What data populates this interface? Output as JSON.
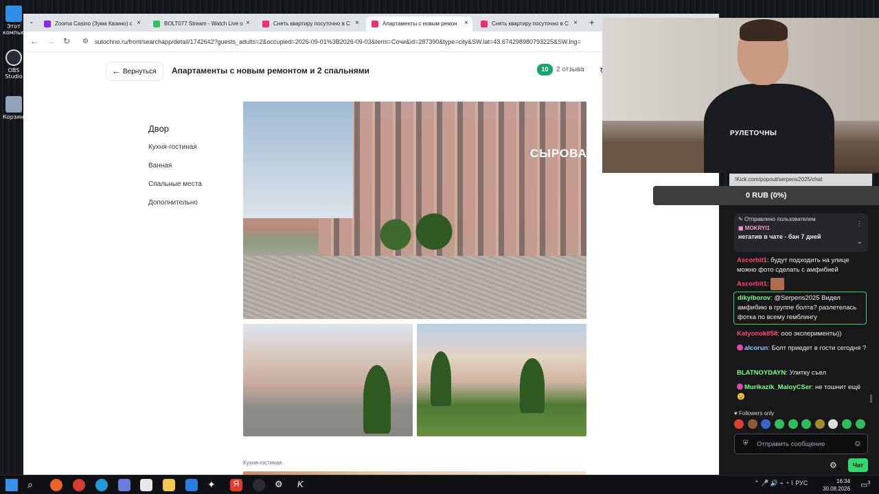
{
  "desktop": {
    "icons": [
      {
        "label": "Этот компьютер",
        "color": "#2f8fe8"
      },
      {
        "label": "OBS Studio",
        "color": "#2a2d33"
      },
      {
        "label": "Корзина",
        "color": "#8fa3b8"
      }
    ]
  },
  "browser": {
    "tabs": [
      {
        "title": "Zooma Casino (Зума Казино) с",
        "fav_color": "#8a2be2"
      },
      {
        "title": "BOLT077 Stream - Watch Live o",
        "fav_color": "#31c45a"
      },
      {
        "title": "Снять квартиру посуточно в С",
        "fav_color": "#e8336d"
      },
      {
        "title": "Апартаменты с новым ремон",
        "fav_color": "#e8336d"
      },
      {
        "title": "Снять квартиру посуточно в С",
        "fav_color": "#e8336d"
      }
    ],
    "new_tab": "+",
    "tab_list_icon": "chevron-down",
    "close_glyph": "×",
    "nav": {
      "back": "←",
      "forward": "→",
      "reload": "↻"
    },
    "url": "sutochno.ru/front/searchapp/detail/1742642?guests_adults=2&occupied=2026-09-01%3B2026-09-03&term=Сочи&id=287390&type=city&SW.lat=43.674298980793225&SW.lng="
  },
  "page": {
    "back_label": "Вернуться",
    "title": "Апартаменты с новым ремонтом и 2 спальнями",
    "rating": "10",
    "reviews": "2 отзыва",
    "active_section": "Двор",
    "sections": [
      "Кухня-гостиная",
      "Ванная",
      "Спальные места",
      "Дополнительно"
    ],
    "photo_sign": "СЫРОВА",
    "kitchen_caption": "Кухня-гостиная"
  },
  "webcam": {
    "shirt_text": "РУЛЕТОЧНЫ"
  },
  "overlay": {
    "chat_url": "!Kick.com/popout/serpens2025/chat",
    "donation": "0 RUB (0%)"
  },
  "chat": {
    "pinned": {
      "header": "Отправлено пользователем",
      "user": "MOKRYI1",
      "text": "негатив в чате - бан 7 дней"
    },
    "messages": [
      {
        "user": "Ascorbit1",
        "color": "#ff4a6b",
        "text": "будут подходить на улице можно фото сделать с амфибией"
      },
      {
        "user": "Ascorbit1",
        "color": "#ff4a6b",
        "text": ""
      },
      {
        "user": "dikyiborov",
        "color": "#7dff8a",
        "text": "@Serpens2025 Видел амфибию в группе болта? разлетелась фотка по всему гемблингу"
      },
      {
        "user": "Katyonok858",
        "color": "#ff4a6b",
        "text": "ооо эксперименты))"
      },
      {
        "user": "alcorun",
        "color": "#8fc7ff",
        "text": "Болт приедет в гости сегодня ?"
      },
      {
        "user": "BLATNOYDAYN",
        "color": "#7dff8a",
        "text": "Улитку съел"
      },
      {
        "user": "Murikazik_MaloyCSer",
        "color": "#7dff8a",
        "text": "не тошнит ещё 😉"
      }
    ],
    "followers_only": "Followers only",
    "input_placeholder": "Отправить сообщение",
    "chat_button": "Чат"
  },
  "taskbar": {
    "tray_lang": "РУС",
    "time": "16:34",
    "date": "30.08.2026",
    "notifications": "3"
  }
}
